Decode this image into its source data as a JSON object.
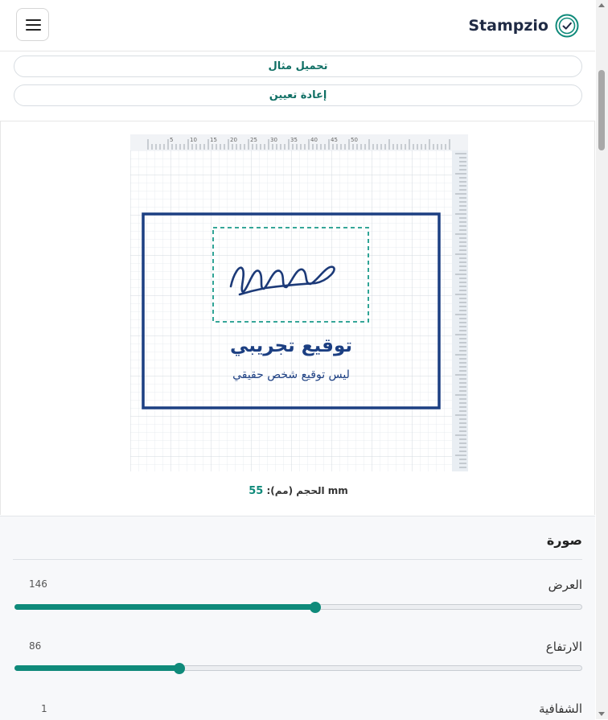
{
  "header": {
    "brand": "Stampzio",
    "menu_icon": "hamburger-icon",
    "logo_icon": "check-badge-icon",
    "brand_color": "#0f8a7a"
  },
  "actions": {
    "load_example": "تحميل مثال",
    "reset": "إعادة تعيين"
  },
  "preview": {
    "ruler_ticks": [
      "5",
      "10",
      "15",
      "20",
      "25",
      "30",
      "35",
      "40",
      "45",
      "50"
    ],
    "stamp_title": "توقيع تجريبي",
    "stamp_subtitle": "ليس توقيع شخص حقيقي",
    "border_color": "#1c3f82",
    "signature_box_color": "#1a9a8a",
    "size_label": "الحجم (مم):",
    "size_value": "55",
    "size_unit": "mm"
  },
  "image_section": {
    "title": "صورة",
    "width_label": "العرض",
    "width_value": "146",
    "width_fraction": 0.53,
    "height_label": "الارتفاع",
    "height_value": "86",
    "height_fraction": 0.29,
    "opacity_label": "الشفافية",
    "opacity_value": "1"
  }
}
